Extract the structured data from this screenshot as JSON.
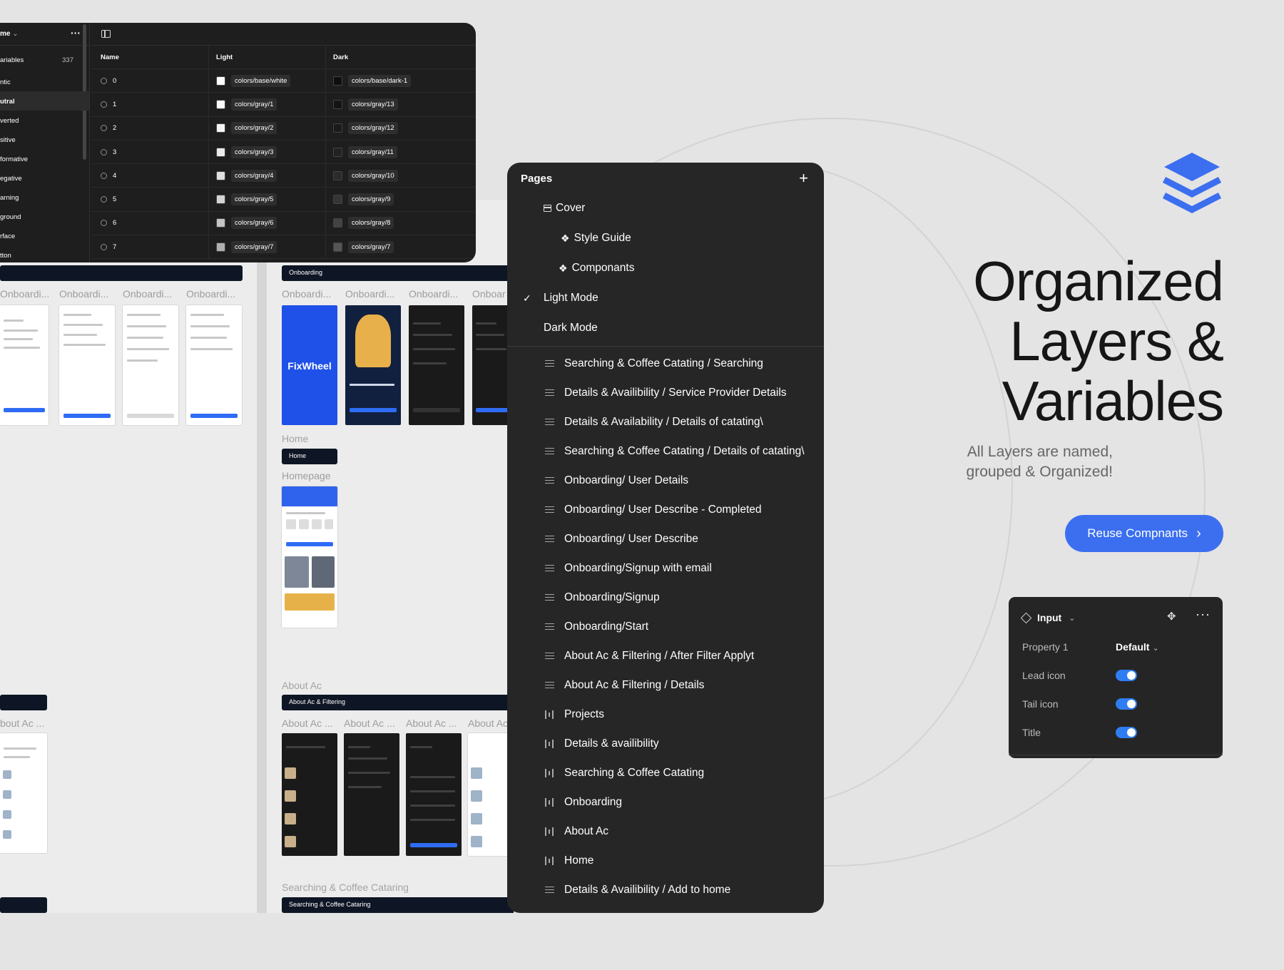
{
  "variables_panel": {
    "collection_name": "me",
    "sidebar": {
      "all_label": "ariables",
      "all_count": "337",
      "groups": [
        "ntic",
        "utral",
        "verted",
        "sitive",
        "formative",
        "egative",
        "arning",
        "ground",
        "rface",
        "tton"
      ],
      "active_index": 1
    },
    "columns": [
      "Name",
      "Light",
      "Dark"
    ],
    "rows": [
      {
        "name": "0",
        "light": "colors/base/white",
        "dark": "colors/base/dark-1",
        "light_color": "#ffffff",
        "dark_color": "#0e0e0e"
      },
      {
        "name": "1",
        "light": "colors/gray/1",
        "dark": "colors/gray/13",
        "light_color": "#fbfbfb",
        "dark_color": "#141414"
      },
      {
        "name": "2",
        "light": "colors/gray/2",
        "dark": "colors/gray/12",
        "light_color": "#f4f4f4",
        "dark_color": "#1b1b1b"
      },
      {
        "name": "3",
        "light": "colors/gray/3",
        "dark": "colors/gray/11",
        "light_color": "#ebebeb",
        "dark_color": "#222222"
      },
      {
        "name": "4",
        "light": "colors/gray/4",
        "dark": "colors/gray/10",
        "light_color": "#e0e0e0",
        "dark_color": "#2b2b2b"
      },
      {
        "name": "5",
        "light": "colors/gray/5",
        "dark": "colors/gray/9",
        "light_color": "#d4d4d4",
        "dark_color": "#353535"
      },
      {
        "name": "6",
        "light": "colors/gray/6",
        "dark": "colors/gray/8",
        "light_color": "#c4c4c4",
        "dark_color": "#424242"
      },
      {
        "name": "7",
        "light": "colors/gray/7",
        "dark": "colors/gray/7",
        "light_color": "#b0b0b0",
        "dark_color": "#555555"
      }
    ]
  },
  "canvas": {
    "left_section": {
      "frame_labels": [
        "Onboardi...",
        "Onboardi...",
        "Onboardi...",
        "Onboardi..."
      ],
      "about_label": "bout Ac ..."
    },
    "onboarding": {
      "bar_label": "Onboarding",
      "frame_labels": [
        "Onboardi...",
        "Onboardi...",
        "Onboardi...",
        "Onboar"
      ],
      "brand_name": "FixWheel"
    },
    "home": {
      "section_label": "Home",
      "bar_label": "Home",
      "frame_label": "Homepage"
    },
    "about": {
      "section_label": "About Ac",
      "bar_label": "About Ac & Filtering",
      "frame_labels": [
        "About Ac ...",
        "About Ac ...",
        "About Ac ...",
        "About Ac"
      ]
    },
    "searching": {
      "section_label": "Searching & Coffee Cataring",
      "bar_label": "Searching & Coffee Cataring"
    }
  },
  "pages_panel": {
    "title": "Pages",
    "add_icon": "plus-icon",
    "top_pages": [
      {
        "label": "Cover",
        "icon": "frame-icon"
      },
      {
        "label": "Style Guide",
        "icon": "component-icon"
      },
      {
        "label": "Componants",
        "icon": "component-icon"
      },
      {
        "label": "Light Mode",
        "icon": "check-icon",
        "selected": true
      },
      {
        "label": "Dark Mode",
        "icon": ""
      }
    ],
    "layers": [
      {
        "label": "Searching & Coffee Catating / Searching",
        "icon": "rows"
      },
      {
        "label": "Details & Availibility / Service Provider Details",
        "icon": "rows"
      },
      {
        "label": "Details & Availability / Details of catating\\",
        "icon": "rows"
      },
      {
        "label": "Searching & Coffee Catating / Details of catating\\",
        "icon": "rows"
      },
      {
        "label": "Onboarding/ User Details",
        "icon": "rows"
      },
      {
        "label": "Onboarding/ User Describe - Completed",
        "icon": "rows"
      },
      {
        "label": "Onboarding/ User Describe",
        "icon": "rows"
      },
      {
        "label": "Onboarding/Signup with email",
        "icon": "rows"
      },
      {
        "label": "Onboarding/Signup",
        "icon": "rows"
      },
      {
        "label": "Onboarding/Start",
        "icon": "rows"
      },
      {
        "label": "About Ac & Filtering / After Filter Applyt",
        "icon": "rows"
      },
      {
        "label": "About Ac & Filtering / Details",
        "icon": "rows"
      },
      {
        "label": "Projects",
        "icon": "columns"
      },
      {
        "label": "Details & availibility",
        "icon": "columns"
      },
      {
        "label": "Searching & Coffee Catating",
        "icon": "columns"
      },
      {
        "label": "Onboarding",
        "icon": "columns"
      },
      {
        "label": "About Ac",
        "icon": "columns"
      },
      {
        "label": "Home",
        "icon": "columns"
      },
      {
        "label": "Details & Availibility / Add to home",
        "icon": "rows"
      }
    ]
  },
  "marketing": {
    "logo_icon": "stacked-layers-icon",
    "brand_color": "#3b6ff0",
    "headline": [
      "Organized",
      "Layers &",
      "Variables"
    ],
    "subhead": "All Layers are named, grouped & Organized!",
    "cta_label": "Reuse Compnants"
  },
  "properties_card": {
    "component_name": "Input",
    "property_1_label": "Property 1",
    "property_1_value": "Default",
    "toggles": [
      {
        "label": "Lead icon",
        "on": true
      },
      {
        "label": "Tail icon",
        "on": true
      },
      {
        "label": "Title",
        "on": true
      }
    ]
  }
}
